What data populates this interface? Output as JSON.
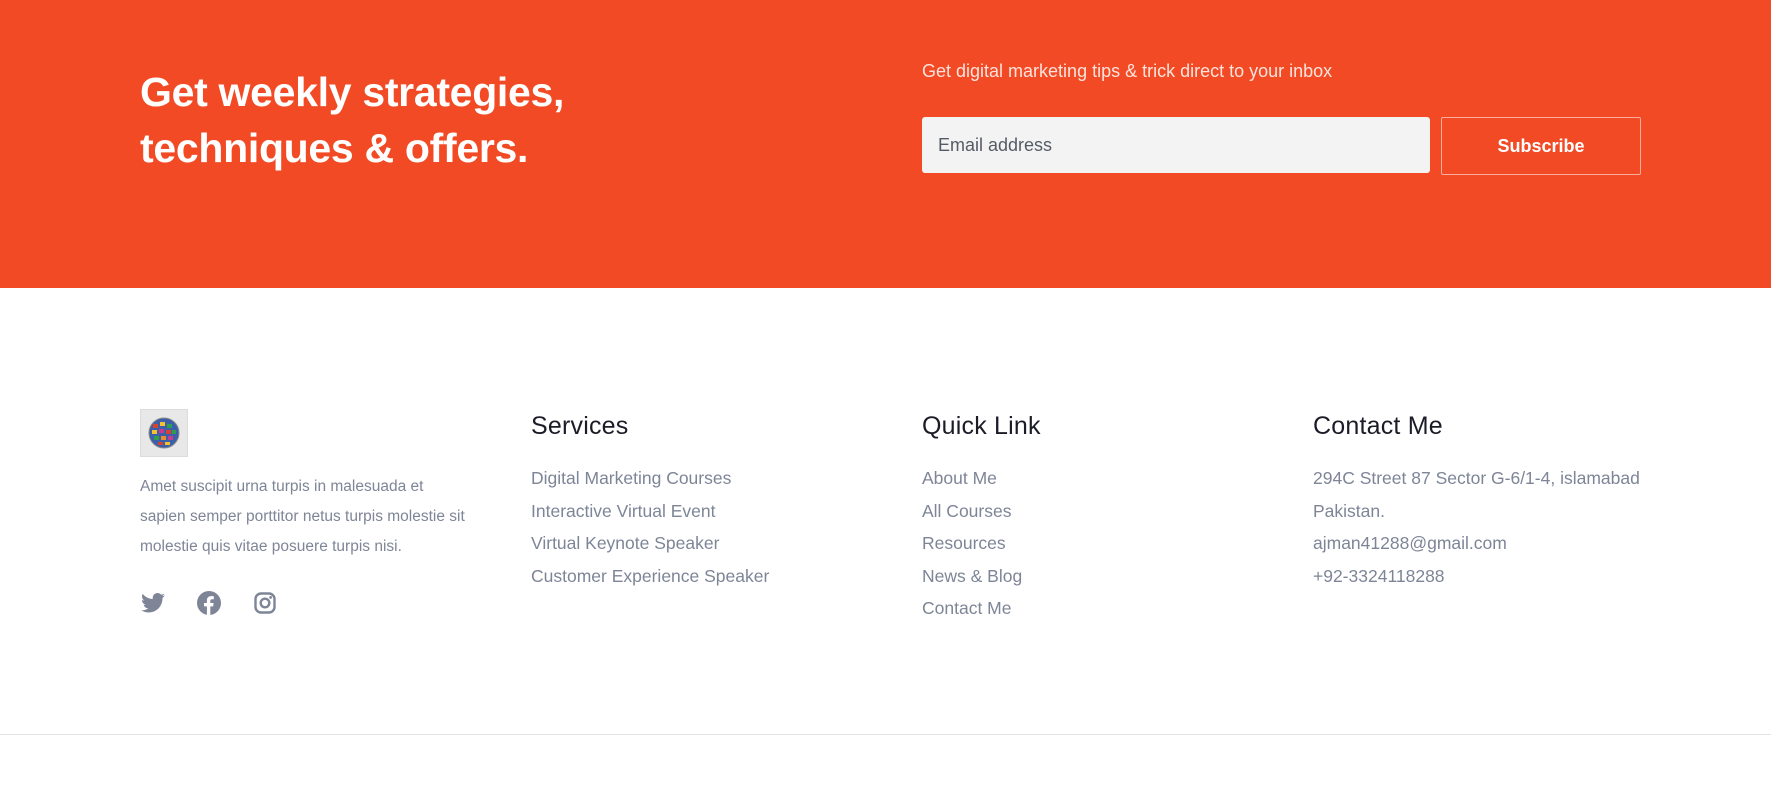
{
  "newsletter": {
    "heading": "Get weekly strategies, techniques & offers.",
    "tagline": "Get digital marketing tips & trick direct to your inbox",
    "email_placeholder": "Email address",
    "subscribe_label": "Subscribe",
    "background_color": "#f24a24"
  },
  "footer": {
    "about": {
      "text": "Amet suscipit urna turpis in malesuada et sapien semper porttitor netus turpis molestie sit molestie quis vitae posuere turpis nisi.",
      "socials": [
        "twitter-icon",
        "facebook-icon",
        "instagram-icon"
      ]
    },
    "services": {
      "title": "Services",
      "items": [
        "Digital Marketing Courses",
        "Interactive Virtual Event",
        "Virtual Keynote Speaker",
        "Customer Experience Speaker"
      ]
    },
    "quick_link": {
      "title": "Quick Link",
      "items": [
        "About Me",
        "All Courses",
        "Resources",
        "News & Blog",
        "Contact Me"
      ]
    },
    "contact": {
      "title": "Contact Me",
      "items": [
        "294C Street 87 Sector G-6/1-4, islamabad Pakistan.",
        "ajman41288@gmail.com",
        "+92-3324118288"
      ]
    }
  }
}
